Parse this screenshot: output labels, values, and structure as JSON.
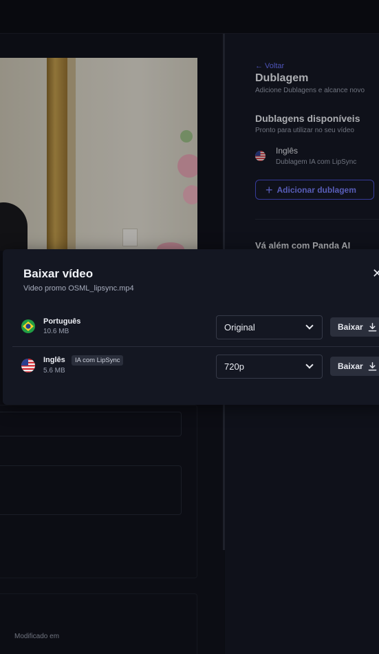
{
  "right_panel": {
    "back_label": "← Voltar",
    "title": "Dublagem",
    "subtitle": "Adicione Dublagens e alcance novo",
    "available_title": "Dublagens disponíveis",
    "available_subtitle": "Pronto para utilizar no seu vídeo",
    "dub_item": {
      "language": "Inglês",
      "description": "Dublagem IA com LipSync",
      "flag": "us-flag-icon"
    },
    "add_button_label": "Adicionar dublagem",
    "panda_title": "Vá além com Panda AI"
  },
  "left_panel": {
    "modified_label": "Modificado em"
  },
  "modal": {
    "title": "Baixar vídeo",
    "filename": "Video promo OSML_lipsync.mp4",
    "close_icon": "close-icon",
    "rows": [
      {
        "language": "Português",
        "size": "10.6 MB",
        "flag": "brazil-flag-icon",
        "quality": "Original",
        "download_label": "Baixar"
      },
      {
        "language": "Inglês",
        "size": "5.6 MB",
        "flag": "us-flag-icon",
        "badge": "IA com LipSync",
        "quality": "720p",
        "download_label": "Baixar"
      }
    ]
  },
  "colors": {
    "accent": "#6b74ff",
    "background": "#0f111a",
    "modal": "#141722"
  }
}
